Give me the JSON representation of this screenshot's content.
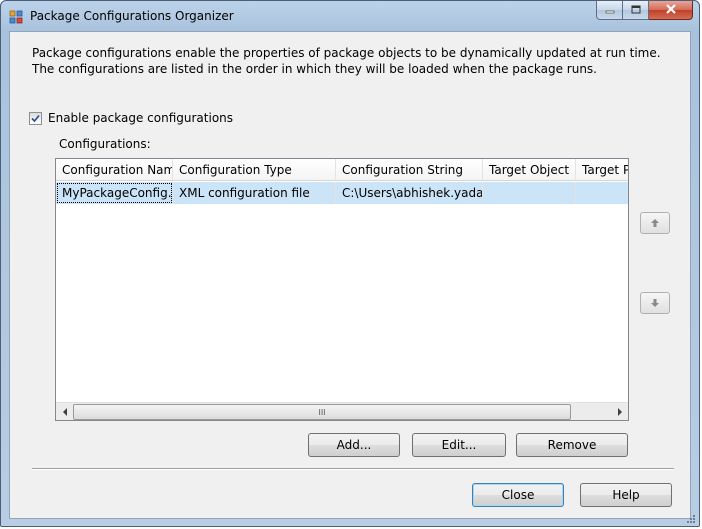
{
  "window": {
    "title": "Package Configurations Organizer",
    "minimize_icon": "minimize-icon",
    "maximize_icon": "maximize-icon",
    "close_icon": "close-icon"
  },
  "description": "Package configurations enable the properties of package objects to be dynamically updated at run time. The configurations are listed in the order in which they will be loaded when the package runs.",
  "enable_checkbox": {
    "label": "Enable package configurations",
    "checked": true
  },
  "configurations_label": "Configurations:",
  "grid": {
    "columns": [
      "Configuration Name",
      "Configuration Type",
      "Configuration String",
      "Target Object",
      "Target Pr"
    ],
    "rows": [
      [
        "MyPackageConfig...",
        "XML configuration file",
        "C:\\Users\\abhishek.yada...",
        "",
        ""
      ]
    ],
    "scrollbar_grip": "III"
  },
  "move_up_icon": "arrow-up-icon",
  "move_down_icon": "arrow-down-icon",
  "buttons": {
    "add": "Add...",
    "edit": "Edit...",
    "remove": "Remove",
    "close": "Close",
    "help": "Help"
  },
  "colors": {
    "selection": "#cce4f7",
    "frame": "#b9cde3",
    "close_button": "#c0412a"
  }
}
